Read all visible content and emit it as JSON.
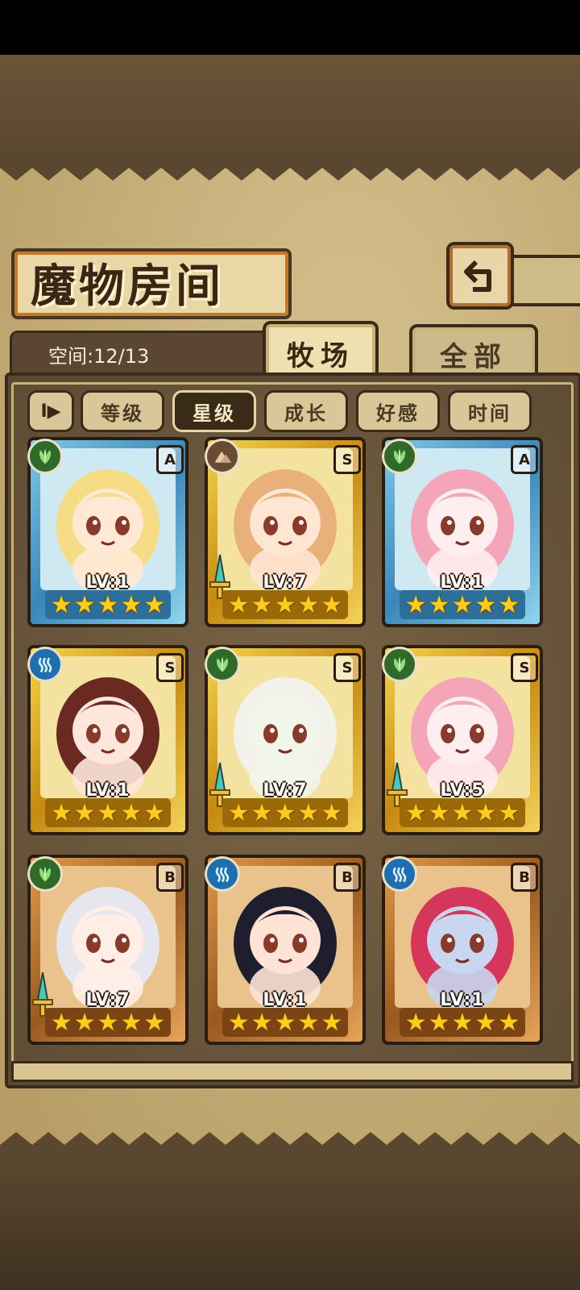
{
  "header": {
    "title": "魔物房间"
  },
  "capacity": {
    "label": "空间:12/13"
  },
  "tabs": [
    {
      "label": "牧场",
      "active": true
    },
    {
      "label": "全部",
      "active": false
    }
  ],
  "sort": {
    "toggle_label": "I▶",
    "buttons": [
      {
        "label": "等级",
        "active": false
      },
      {
        "label": "星级",
        "active": true
      },
      {
        "label": "成长",
        "active": false
      },
      {
        "label": "好感",
        "active": false
      },
      {
        "label": "时间",
        "active": false
      }
    ]
  },
  "monsters": [
    {
      "level": "LV:1",
      "rank": "A",
      "element": "leaf-icon",
      "frame": "blue",
      "stars": 5,
      "weapon": false,
      "hair": "#f6dc84",
      "skin": "#ffe9d6"
    },
    {
      "level": "LV:7",
      "rank": "S",
      "element": "mountain-icon",
      "frame": "gold",
      "stars": 5,
      "weapon": true,
      "hair": "#e8b07a",
      "skin": "#ffe6d2"
    },
    {
      "level": "LV:1",
      "rank": "A",
      "element": "leaf-icon",
      "frame": "blue",
      "stars": 5,
      "weapon": false,
      "hair": "#f4a6b8",
      "skin": "#ffeef0"
    },
    {
      "level": "LV:1",
      "rank": "S",
      "element": "water-icon",
      "frame": "gold",
      "stars": 5,
      "weapon": false,
      "hair": "#6a2a22",
      "skin": "#ffe6dc"
    },
    {
      "level": "LV:7",
      "rank": "S",
      "element": "leaf-icon",
      "frame": "gold",
      "stars": 5,
      "weapon": true,
      "hair": "#f2f2ea",
      "skin": "#f2f6ea"
    },
    {
      "level": "LV:5",
      "rank": "S",
      "element": "leaf-icon",
      "frame": "gold",
      "stars": 5,
      "weapon": true,
      "hair": "#f4a6b8",
      "skin": "#ffeef0"
    },
    {
      "level": "LV:7",
      "rank": "B",
      "element": "leaf-icon",
      "frame": "bronze",
      "stars": 5,
      "weapon": true,
      "hair": "#e6e6ee",
      "skin": "#ffeee6"
    },
    {
      "level": "LV:1",
      "rank": "B",
      "element": "water-icon",
      "frame": "bronze",
      "stars": 5,
      "weapon": false,
      "hair": "#1e1e2e",
      "skin": "#ffe4d6"
    },
    {
      "level": "LV:1",
      "rank": "B",
      "element": "water-icon",
      "frame": "bronze",
      "stars": 5,
      "weapon": false,
      "hair": "#d6365a",
      "skin": "#c8d6f0"
    }
  ],
  "colors": {
    "frame_blue": "#3a86b8",
    "frame_gold": "#c68a10",
    "frame_bronze": "#9a5a1e",
    "star": "#ffcc1a"
  }
}
